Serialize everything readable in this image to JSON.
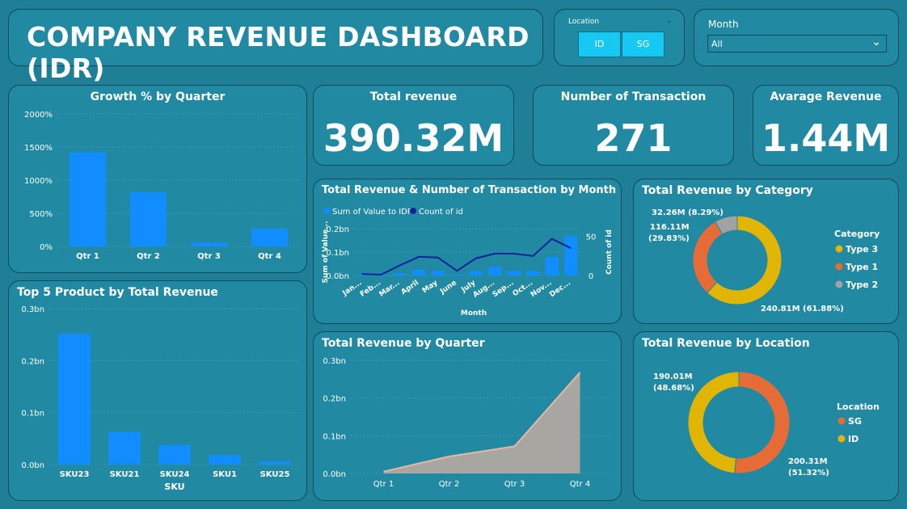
{
  "header": {
    "title": "COMPANY REVENUE DASHBOARD (IDR)"
  },
  "location_slicer": {
    "label": "Location",
    "options": [
      "ID",
      "SG"
    ]
  },
  "month_slicer": {
    "label": "Month",
    "value": "All"
  },
  "kpis": {
    "total_revenue": {
      "label": "Total revenue",
      "value": "390.32M"
    },
    "transactions": {
      "label": "Number of Transaction",
      "value": "271"
    },
    "avg_revenue": {
      "label": "Avarage Revenue",
      "value": "1.44M"
    }
  },
  "colors": {
    "bar": "#118dff",
    "line": "#12239e",
    "area": "#a8a6a1",
    "area_line": "#e8b7a2",
    "type3": "#e0b503",
    "type1": "#e66c37",
    "type2": "#a2a2a2",
    "sg": "#e66c37",
    "id": "#e0b503"
  },
  "chart_data": [
    {
      "id": "growth",
      "type": "bar",
      "title": "Growth % by Quarter",
      "categories": [
        "Qtr 1",
        "Qtr 2",
        "Qtr 3",
        "Qtr 4"
      ],
      "values": [
        1420,
        820,
        60,
        270
      ],
      "ylim": [
        0,
        2000
      ],
      "yticks": [
        "0%",
        "500%",
        "1000%",
        "1500%",
        "2000%"
      ]
    },
    {
      "id": "top5",
      "type": "bar",
      "title": "Top 5 Product by Total Revenue",
      "xlabel": "SKU",
      "categories": [
        "SKU23",
        "SKU21",
        "SKU24",
        "SKU1",
        "SKU25"
      ],
      "values": [
        0.252,
        0.063,
        0.038,
        0.018,
        0.006
      ],
      "ylim": [
        0,
        0.3
      ],
      "yticks": [
        "0.0bn",
        "0.1bn",
        "0.2bn",
        "0.3bn"
      ]
    },
    {
      "id": "monthly",
      "type": "bar",
      "title": "Total Revenue & Number of Transaction by Month",
      "xlabel": "Month",
      "ylabel": "Sum of Value...",
      "y2label": "Count of id",
      "legend": [
        "Sum of Value to IDR",
        "Count of id"
      ],
      "categories": [
        "Jan...",
        "Feb...",
        "Mar...",
        "April",
        "May",
        "June",
        "July",
        "Aug...",
        "Sep...",
        "Oct...",
        "Nov...",
        "Dec..."
      ],
      "series": [
        {
          "name": "Sum of Value to IDR",
          "values": [
            0.003,
            0.004,
            0.01,
            0.025,
            0.02,
            0.005,
            0.02,
            0.038,
            0.02,
            0.02,
            0.08,
            0.17
          ]
        },
        {
          "name": "Count of id",
          "values": [
            2,
            1,
            13,
            24,
            23,
            6,
            22,
            28,
            28,
            25,
            47,
            35
          ]
        }
      ],
      "ylim": [
        0,
        0.2
      ],
      "y2lim": [
        0,
        60
      ],
      "yticks": [
        "0.0bn",
        "0.1bn",
        "0.2bn"
      ],
      "y2ticks": [
        "0",
        "50"
      ]
    },
    {
      "id": "quarter",
      "type": "area",
      "title": "Total Revenue by Quarter",
      "categories": [
        "Qtr 1",
        "Qtr 2",
        "Qtr 3",
        "Qtr 4"
      ],
      "values": [
        0.005,
        0.045,
        0.072,
        0.268
      ],
      "ylim": [
        0,
        0.3
      ],
      "yticks": [
        "0.0bn",
        "0.1bn",
        "0.2bn",
        "0.3bn"
      ]
    },
    {
      "id": "category",
      "type": "pie",
      "title": "Total Revenue by Category",
      "legend_title": "Category",
      "slices": [
        {
          "name": "Type 3",
          "value": 240.81,
          "label": "240.81M (61.88%)"
        },
        {
          "name": "Type 1",
          "value": 116.11,
          "label": "116.11M (29.83%)"
        },
        {
          "name": "Type 2",
          "value": 32.26,
          "label": "32.26M (8.29%)"
        }
      ]
    },
    {
      "id": "location",
      "type": "pie",
      "title": "Total Revenue by Location",
      "legend_title": "Location",
      "slices": [
        {
          "name": "SG",
          "value": 200.31,
          "label_line1": "200.31M",
          "label_line2": "(51.32%)"
        },
        {
          "name": "ID",
          "value": 190.01,
          "label_line1": "190.01M",
          "label_line2": "(48.68%)"
        }
      ]
    }
  ]
}
